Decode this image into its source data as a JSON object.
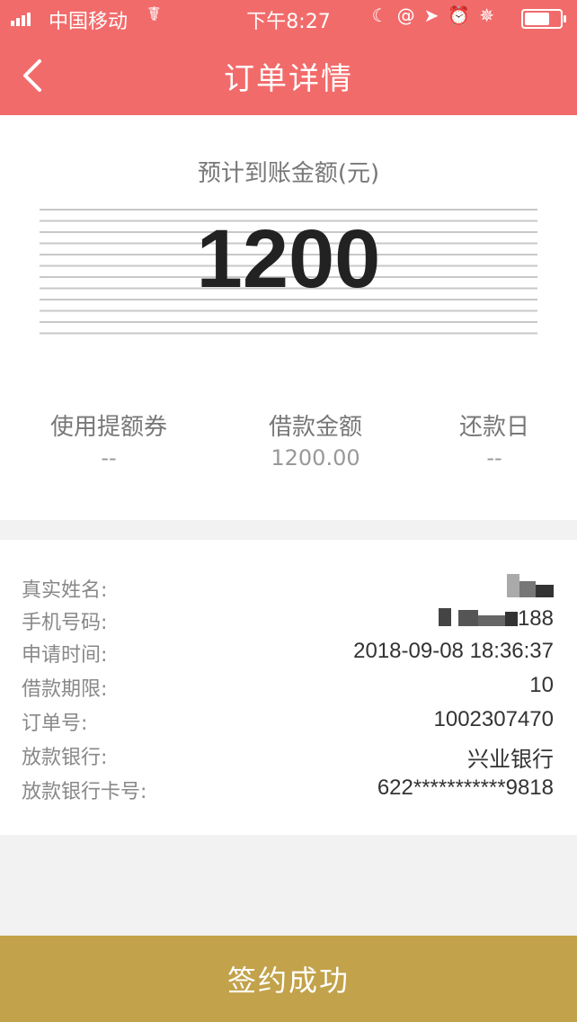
{
  "status_bar": {
    "carrier": "中国移动",
    "time": "下午8:27",
    "battery_level": 0.7
  },
  "nav": {
    "title": "订单详情",
    "back_icon": "chevron-left-icon"
  },
  "amount": {
    "label": "预计到账金额(元)",
    "value": "1200"
  },
  "summary": [
    {
      "label": "使用提额券",
      "value": "--"
    },
    {
      "label": "借款金额",
      "value": "1200.00"
    },
    {
      "label": "还款日",
      "value": "--"
    }
  ],
  "details": [
    {
      "key": "真实姓名:",
      "value": ""
    },
    {
      "key": "手机号码:",
      "value": "188"
    },
    {
      "key": "申请时间:",
      "value": "2018-09-08 18:36:37"
    },
    {
      "key": "借款期限:",
      "value": "10"
    },
    {
      "key": "订单号:",
      "value": "1002307470"
    },
    {
      "key": "放款银行:",
      "value": "兴业银行"
    },
    {
      "key": "放款银行卡号:",
      "value": "622***********9818"
    }
  ],
  "action": {
    "label": "签约成功"
  },
  "colors": {
    "header": "#f26b6b",
    "action_bar": "#c2a24a"
  }
}
